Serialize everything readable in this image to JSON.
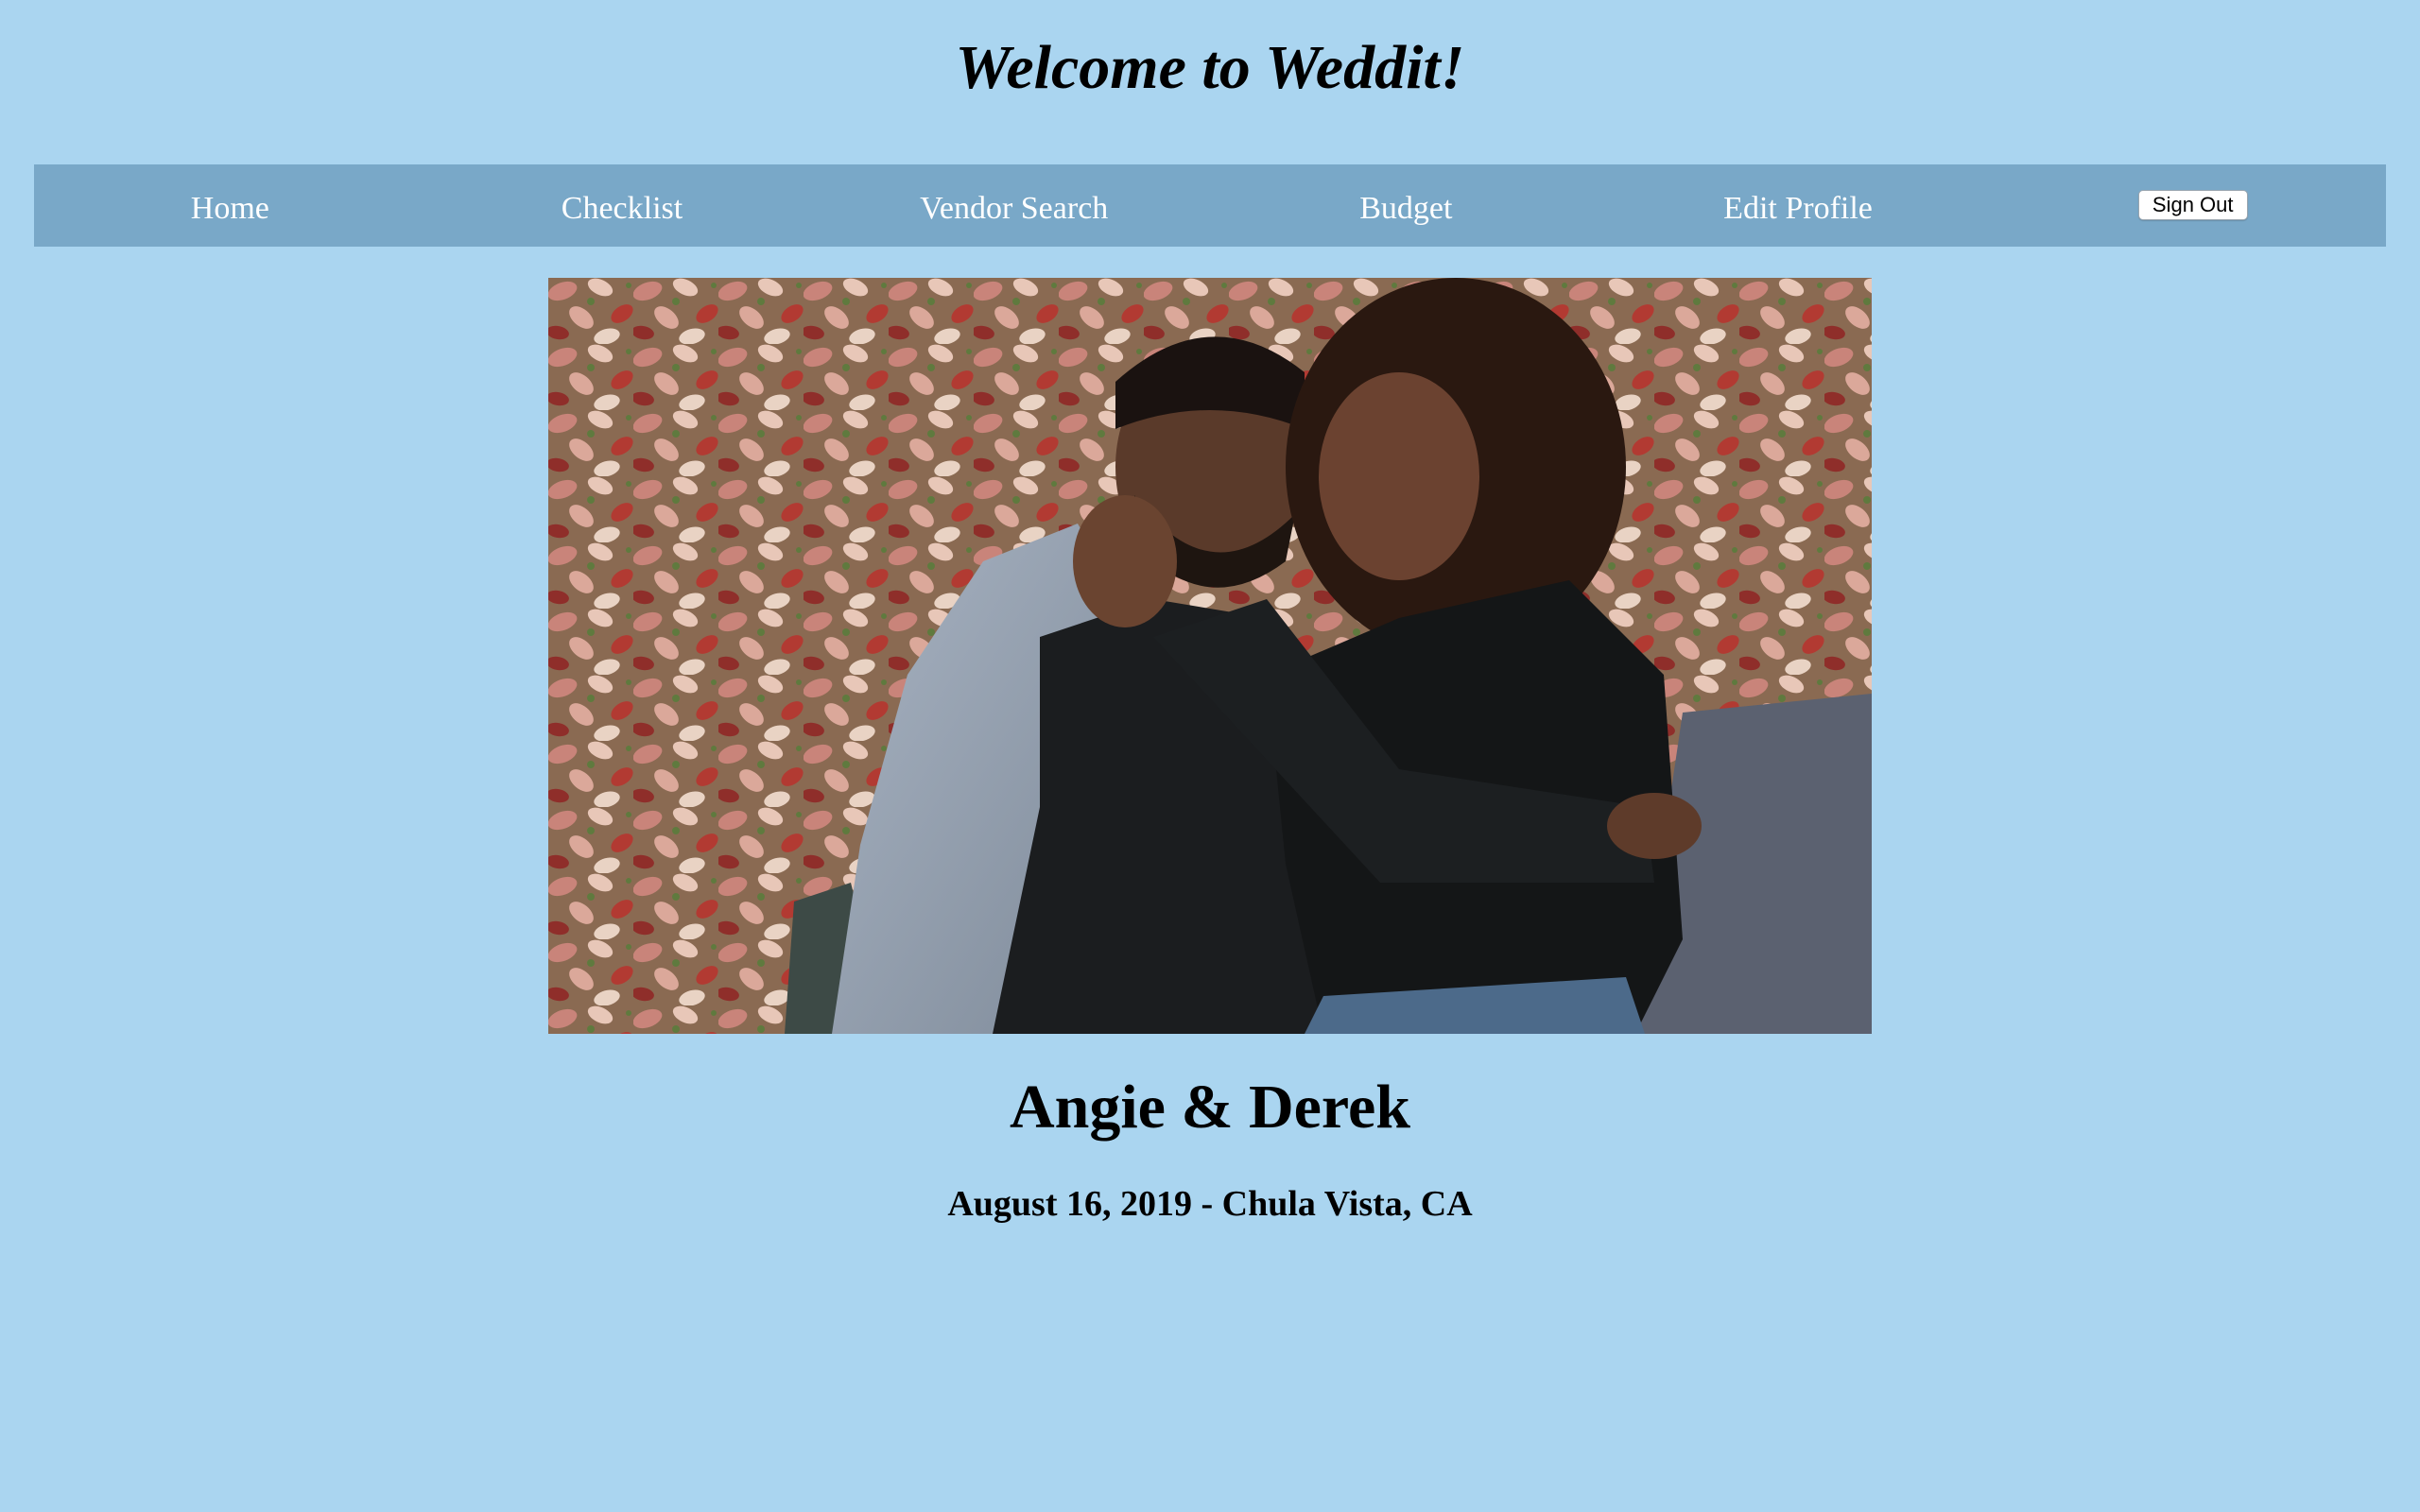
{
  "header": {
    "title": "Welcome to Weddit!"
  },
  "nav": {
    "items": [
      {
        "label": "Home"
      },
      {
        "label": "Checklist"
      },
      {
        "label": "Vendor Search"
      },
      {
        "label": "Budget"
      },
      {
        "label": "Edit Profile"
      }
    ],
    "sign_out_label": "Sign Out"
  },
  "profile": {
    "names": "Angie & Derek",
    "details": "August 16, 2019 - Chula Vista, CA",
    "photo_alt": "couple-engagement-photo"
  },
  "colors": {
    "background": "#aad5f0",
    "nav_bar": "#79a8c8",
    "nav_text": "#ffffff"
  }
}
